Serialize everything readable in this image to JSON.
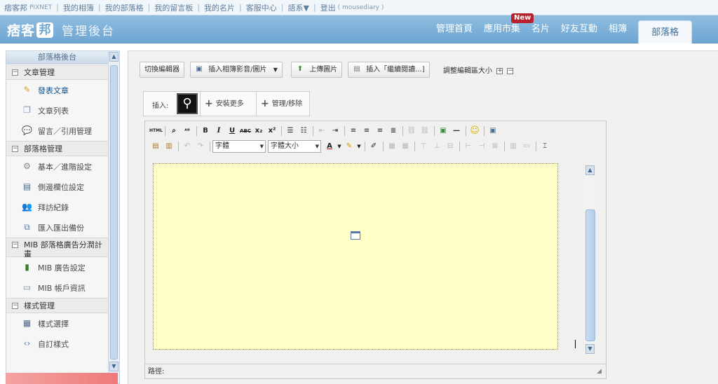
{
  "topbar": {
    "brand": "痞客邦",
    "brand_sub": "PIXNET",
    "links": [
      "我的相簿",
      "我的部落格",
      "我的留言板",
      "我的名片",
      "客服中心",
      "語系▼",
      "登出"
    ],
    "user": "( mousediary )"
  },
  "header": {
    "logo_text": "痞客",
    "logo_char": "邦",
    "subtitle": "管理後台",
    "nav": [
      "管理首頁",
      "應用市集",
      "名片",
      "好友互動",
      "相簿",
      "部落格"
    ],
    "active_nav": "部落格",
    "new_badge": "New"
  },
  "sidebar": {
    "title": "部落格後台",
    "sections": [
      {
        "label": "文章管理",
        "items": [
          "發表文章",
          "文章列表",
          "留言／引用管理"
        ]
      },
      {
        "label": "部落格管理",
        "items": [
          "基本／進階設定",
          "側邊欄位設定",
          "拜訪紀錄",
          "匯入匯出備份"
        ]
      },
      {
        "label": "MIB 部落格廣告分潤計畫",
        "items": [
          "MIB 廣告設定",
          "MIB 帳戶資訊"
        ]
      },
      {
        "label": "樣式管理",
        "items": [
          "樣式選擇",
          "自訂樣式"
        ]
      }
    ]
  },
  "toolbar": {
    "switch_editor": "切換編輯器",
    "insert_media": "插入相簿影音/圖片",
    "upload_image": "上傳圖片",
    "insert_more": "插入「繼續閱讀...]",
    "resize_label": "調整編輯區大小"
  },
  "insert_bar": {
    "label": "插入:",
    "install_more": "安裝更多",
    "manage_remove": "管理/移除"
  },
  "editor": {
    "font_select": "字體",
    "size_select": "字體大小",
    "path_label": "路徑:"
  },
  "colors": {
    "header_blue": "#7fb2da",
    "editor_bg": "#ffffc7",
    "badge_red": "#b9222a"
  }
}
